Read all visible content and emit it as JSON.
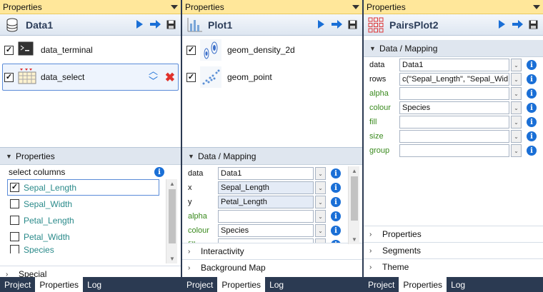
{
  "panels": [
    {
      "title": "Properties",
      "header": "Data1",
      "items": [
        {
          "label": "data_terminal",
          "checked": true,
          "icon": "terminal-icon"
        },
        {
          "label": "data_select",
          "checked": true,
          "icon": "table-select-icon"
        }
      ],
      "section": "Properties",
      "select_columns_label": "select columns",
      "columns": [
        {
          "label": "Sepal_Length",
          "checked": true
        },
        {
          "label": "Sepal_Width",
          "checked": false
        },
        {
          "label": "Petal_Length",
          "checked": false
        },
        {
          "label": "Petal_Width",
          "checked": false
        },
        {
          "label": "Species",
          "checked": false
        }
      ],
      "collapsed": [
        "Special"
      ],
      "tabs": [
        "Project",
        "Properties",
        "Log"
      ],
      "active_tab": "Properties"
    },
    {
      "title": "Properties",
      "header": "Plot1",
      "items": [
        {
          "label": "geom_density_2d",
          "checked": true,
          "icon": "density-2d-icon"
        },
        {
          "label": "geom_point",
          "checked": true,
          "icon": "scatter-point-icon"
        }
      ],
      "section": "Data / Mapping",
      "mapping": [
        {
          "label": "data",
          "value": "Data1",
          "green": false
        },
        {
          "label": "x",
          "value": "Sepal_Length",
          "green": false
        },
        {
          "label": "y",
          "value": "Petal_Length",
          "green": false
        },
        {
          "label": "alpha",
          "value": "",
          "green": true
        },
        {
          "label": "colour",
          "value": "Species",
          "green": true
        },
        {
          "label": "fill",
          "value": "",
          "green": true
        }
      ],
      "collapsed": [
        "Interactivity",
        "Background Map"
      ],
      "tabs": [
        "Project",
        "Properties",
        "Log"
      ],
      "active_tab": "Properties"
    },
    {
      "title": "Properties",
      "header": "PairsPlot2",
      "section": "Data / Mapping",
      "mapping": [
        {
          "label": "data",
          "value": "Data1",
          "green": false
        },
        {
          "label": "rows",
          "value": "c(\"Sepal_Length\", \"Sepal_Wid",
          "green": false
        },
        {
          "label": "alpha",
          "value": "",
          "green": true
        },
        {
          "label": "colour",
          "value": "Species",
          "green": true
        },
        {
          "label": "fill",
          "value": "",
          "green": true
        },
        {
          "label": "size",
          "value": "",
          "green": true
        },
        {
          "label": "group",
          "value": "",
          "green": true
        }
      ],
      "collapsed": [
        "Properties",
        "Segments",
        "Theme"
      ],
      "tabs": [
        "Project",
        "Properties",
        "Log"
      ],
      "active_tab": "Properties"
    }
  ],
  "colors": {
    "accent": "#1a6fd6",
    "titlebar": "#ffe79a",
    "green_label": "#3a8a1e",
    "column_teal": "#2a8a8a",
    "tab_bg": "#2b3a52"
  }
}
